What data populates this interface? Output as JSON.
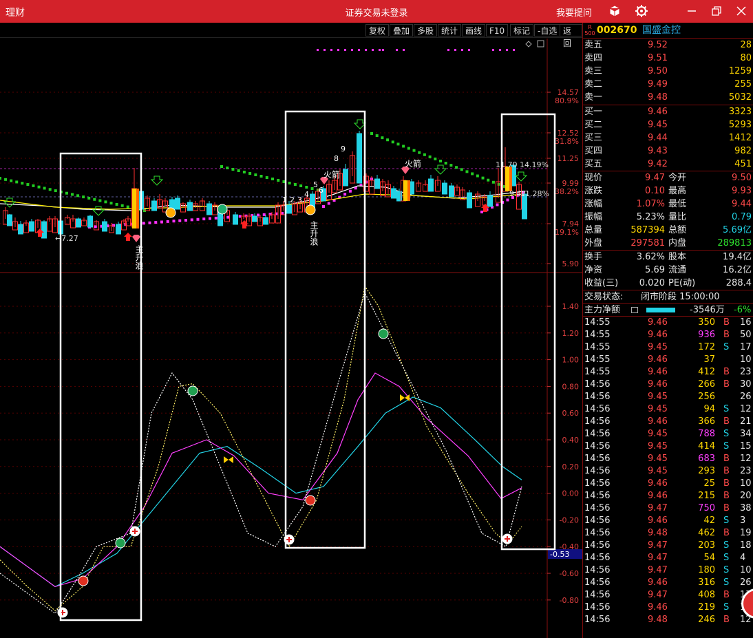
{
  "titlebar": {
    "app": "理财",
    "title": "证券交易未登录",
    "ask": "我要提问"
  },
  "toolbar": [
    "复权",
    "叠加",
    "多股",
    "统计",
    "画线",
    "F10",
    "标记",
    "-自选",
    "返回"
  ],
  "stock": {
    "badge_top": "R",
    "badge_bottom": "500",
    "code": "002670",
    "name": "国盛金控"
  },
  "sells": [
    {
      "label": "卖五",
      "price": "9.52",
      "vol": "28"
    },
    {
      "label": "卖四",
      "price": "9.51",
      "vol": "80"
    },
    {
      "label": "卖三",
      "price": "9.50",
      "vol": "1259"
    },
    {
      "label": "卖二",
      "price": "9.49",
      "vol": "255"
    },
    {
      "label": "卖一",
      "price": "9.48",
      "vol": "5032"
    }
  ],
  "buys": [
    {
      "label": "买一",
      "price": "9.46",
      "vol": "3323"
    },
    {
      "label": "买二",
      "price": "9.45",
      "vol": "5293"
    },
    {
      "label": "买三",
      "price": "9.44",
      "vol": "1412"
    },
    {
      "label": "买四",
      "price": "9.43",
      "vol": "982"
    },
    {
      "label": "买五",
      "price": "9.42",
      "vol": "451"
    }
  ],
  "quote": [
    {
      "l1": "现价",
      "v1": "9.47",
      "c1": "red",
      "l2": "今开",
      "v2": "9.50",
      "c2": "red"
    },
    {
      "l1": "涨跌",
      "v1": "0.10",
      "c1": "red",
      "l2": "最高",
      "v2": "9.93",
      "c2": "red"
    },
    {
      "l1": "涨幅",
      "v1": "1.07%",
      "c1": "red",
      "l2": "最低",
      "v2": "9.44",
      "c2": "red"
    },
    {
      "l1": "振幅",
      "v1": "5.23%",
      "c1": "wht",
      "l2": "量比",
      "v2": "0.79",
      "c2": "cyn"
    },
    {
      "l1": "总量",
      "v1": "587394",
      "c1": "yel",
      "l2": "总额",
      "v2": "5.69亿",
      "c2": "cyn"
    },
    {
      "l1": "外盘",
      "v1": "297581",
      "c1": "red",
      "l2": "内盘",
      "v2": "289813",
      "c2": "grn"
    }
  ],
  "fund": [
    {
      "l1": "换手",
      "v1": "3.62%",
      "l2": "股本",
      "v2": "19.4亿"
    },
    {
      "l1": "净资",
      "v1": "5.69",
      "l2": "流通",
      "v2": "16.2亿"
    },
    {
      "l1": "收益(三)",
      "v1": "0.020",
      "l2": "PE(动)",
      "v2": "288.4"
    }
  ],
  "status": {
    "label": "交易状态:",
    "value": "闭市阶段 15:00:00"
  },
  "mainflow": {
    "label": "主力净额",
    "amount": "-3546万",
    "pct": "-6%"
  },
  "ticks": [
    [
      "14:55",
      "9.46",
      "350",
      "B",
      "16"
    ],
    [
      "14:55",
      "9.46",
      "936",
      "B",
      "50"
    ],
    [
      "14:55",
      "9.45",
      "172",
      "S",
      "17"
    ],
    [
      "14:55",
      "9.46",
      "37",
      "",
      "10"
    ],
    [
      "14:55",
      "9.46",
      "412",
      "B",
      "23"
    ],
    [
      "14:56",
      "9.46",
      "266",
      "B",
      "30"
    ],
    [
      "14:56",
      "9.45",
      "256",
      "",
      "26"
    ],
    [
      "14:56",
      "9.45",
      "94",
      "S",
      "12"
    ],
    [
      "14:56",
      "9.46",
      "366",
      "B",
      "21"
    ],
    [
      "14:56",
      "9.45",
      "788",
      "S",
      "34"
    ],
    [
      "14:56",
      "9.45",
      "414",
      "S",
      "15"
    ],
    [
      "14:56",
      "9.45",
      "683",
      "B",
      "12"
    ],
    [
      "14:56",
      "9.45",
      "293",
      "B",
      "23"
    ],
    [
      "14:56",
      "9.46",
      "25",
      "B",
      "10"
    ],
    [
      "14:56",
      "9.46",
      "215",
      "B",
      "20"
    ],
    [
      "14:56",
      "9.47",
      "750",
      "B",
      "38"
    ],
    [
      "14:56",
      "9.46",
      "42",
      "S",
      "3"
    ],
    [
      "14:56",
      "9.48",
      "462",
      "B",
      "19"
    ],
    [
      "14:56",
      "9.47",
      "203",
      "S",
      "18"
    ],
    [
      "14:56",
      "9.47",
      "54",
      "S",
      "4"
    ],
    [
      "14:56",
      "9.47",
      "180",
      "S",
      "10"
    ],
    [
      "14:56",
      "9.46",
      "316",
      "S",
      "26"
    ],
    [
      "14:56",
      "9.47",
      "408",
      "B",
      "17"
    ],
    [
      "14:56",
      "9.46",
      "219",
      "S",
      "10"
    ],
    [
      "14:56",
      "9.48",
      "246",
      "B",
      "12"
    ]
  ],
  "price_axis": {
    "ticks": [
      "14.57",
      "12.52",
      "11.25",
      "9.99",
      "7.94",
      "5.90"
    ],
    "pcts": [
      "80.9%",
      "31.8%",
      "",
      "38.2%",
      "19.1%",
      ""
    ]
  },
  "ind_axis": {
    "ticks": [
      "1.40",
      "1.20",
      "1.00",
      "0.80",
      "0.60",
      "0.40",
      "0.20",
      "0.00",
      "-0.20",
      "-0.40",
      "-0.60",
      "-0.80"
    ],
    "current": "-0.53"
  },
  "chart_labels": {
    "low": "←7.27",
    "high": "11.70",
    "high_pct": "14.19%",
    "cur": "9.47",
    "cur_pct": "11.28%",
    "rocket": "火箭",
    "wave_up": "主升浪",
    "nums": [
      "1",
      "2",
      "3",
      "4",
      "5",
      "6",
      "8",
      "9"
    ]
  },
  "colors": {
    "up": "#ff3030",
    "down": "#22d3e6",
    "titlebar": "#d3222a"
  }
}
